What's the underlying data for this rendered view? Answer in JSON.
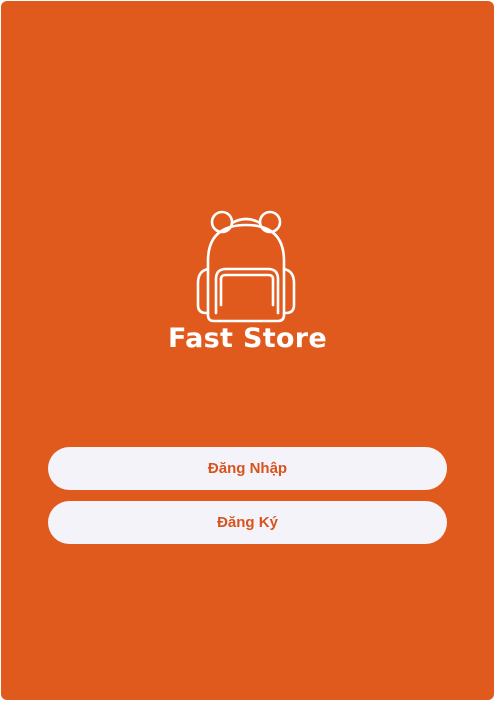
{
  "app": {
    "name": "Fast Store",
    "logo_icon": "backpack-icon"
  },
  "actions": {
    "login_label": "Đăng Nhập",
    "register_label": "Đăng Ký"
  },
  "colors": {
    "background": "#E05A1E",
    "foreground": "#FFFFFF",
    "button_bg": "#F4F3FA",
    "button_text": "#D9531C"
  }
}
